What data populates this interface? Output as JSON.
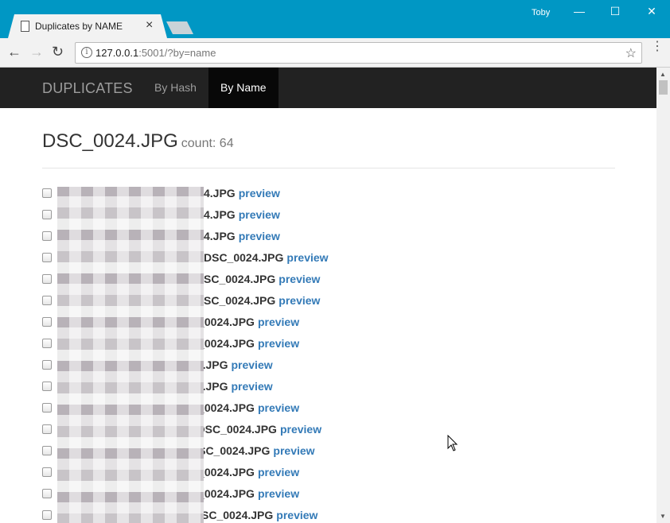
{
  "browser": {
    "tab_title": "Duplicates by NAME",
    "tab_close": "×",
    "user": "Toby",
    "window_controls": {
      "minimize": "—",
      "maximize": "☐",
      "close": "✕"
    },
    "url_host": "127.0.0.1",
    "url_rest": ":5001/?by=name",
    "back": "←",
    "forward": "→",
    "reload": "↻",
    "info": "i",
    "star": "☆",
    "menu": "⋮"
  },
  "navbar": {
    "brand": "DUPLICATES",
    "links": [
      {
        "label": "By Hash",
        "active": false
      },
      {
        "label": "By Name",
        "active": true
      }
    ]
  },
  "main": {
    "title": "DSC_0024.JPG",
    "count_label": "count: 64",
    "preview_label": "preview",
    "rows": [
      {
        "visible_name": "4.JPG"
      },
      {
        "visible_name": "4.JPG"
      },
      {
        "visible_name": "4.JPG"
      },
      {
        "visible_name": "DSC_0024.JPG"
      },
      {
        "visible_name": "SC_0024.JPG"
      },
      {
        "visible_name": "SC_0024.JPG"
      },
      {
        "visible_name": "C_0024.JPG"
      },
      {
        "visible_name": "C_0024.JPG"
      },
      {
        "visible_name": "24.JPG"
      },
      {
        "visible_name": "24.JPG"
      },
      {
        "visible_name": "C_0024.JPG"
      },
      {
        "visible_name": "(\\DSC_0024.JPG"
      },
      {
        "visible_name": "DSC_0024.JPG"
      },
      {
        "visible_name": "C_0024.JPG"
      },
      {
        "visible_name": "C_0024.JPG"
      },
      {
        "visible_name": "\\DSC_0024.JPG"
      }
    ]
  }
}
